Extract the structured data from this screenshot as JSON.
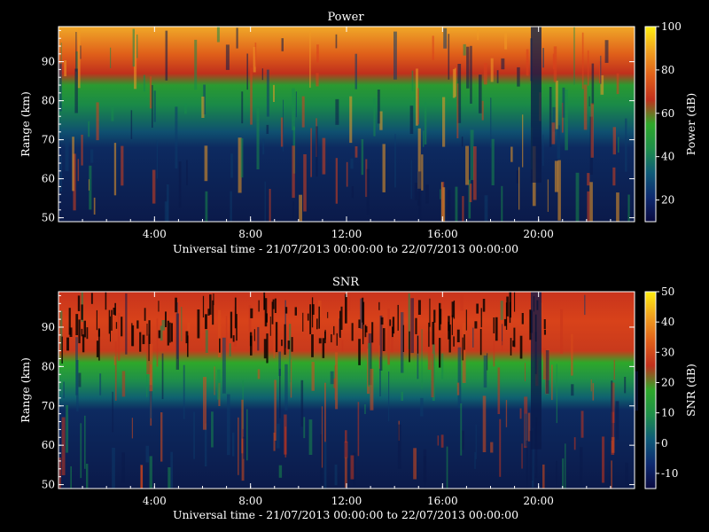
{
  "chart_data": [
    {
      "type": "heatmap",
      "title": "Power",
      "xlabel": "Universal time - 21/07/2013 00:00:00 to 22/07/2013 00:00:00",
      "ylabel": "Range (km)",
      "xlim_hours": [
        0,
        24
      ],
      "ylim_km": [
        49,
        99
      ],
      "x_ticks": [
        "4:00",
        "8:00",
        "12:00",
        "16:00",
        "20:00"
      ],
      "x_tick_hours": [
        4,
        8,
        12,
        16,
        20
      ],
      "y_ticks": [
        50,
        60,
        70,
        80,
        90
      ],
      "colorbar": {
        "label": "Power (dB)",
        "range": [
          10,
          100
        ],
        "ticks": [
          20,
          40,
          60,
          80,
          100
        ]
      },
      "colormap": [
        "#0a0a40",
        "#0e2a70",
        "#0f5b78",
        "#1f8f4a",
        "#2ea82a",
        "#c0301c",
        "#e0601a",
        "#f0a020",
        "#ffee10"
      ],
      "background_colors": [
        "#0b1a4a",
        "#0d3a6a",
        "#188a4a",
        "#d8401c",
        "#f09a24"
      ]
    },
    {
      "type": "heatmap",
      "title": "SNR",
      "xlabel": "Universal time - 21/07/2013 00:00:00 to 22/07/2013 00:00:00",
      "ylabel": "Range (km)",
      "xlim_hours": [
        0,
        24
      ],
      "ylim_km": [
        49,
        99
      ],
      "x_ticks": [
        "4:00",
        "8:00",
        "12:00",
        "16:00",
        "20:00"
      ],
      "x_tick_hours": [
        4,
        8,
        12,
        16,
        20
      ],
      "y_ticks": [
        50,
        60,
        70,
        80,
        90
      ],
      "colorbar": {
        "label": "SNR (dB)",
        "range": [
          -15,
          50
        ],
        "ticks": [
          -10,
          0,
          10,
          20,
          30,
          40,
          50
        ]
      },
      "colormap": [
        "#0a0a40",
        "#0e2a70",
        "#0f5b78",
        "#1f8f4a",
        "#2ea82a",
        "#c0301c",
        "#e0601a",
        "#f0a020",
        "#ffee10"
      ],
      "background_colors": [
        "#0b1a4a",
        "#0d3a6a",
        "#188a4a",
        "#c8341c",
        "#d84a1a"
      ]
    }
  ]
}
